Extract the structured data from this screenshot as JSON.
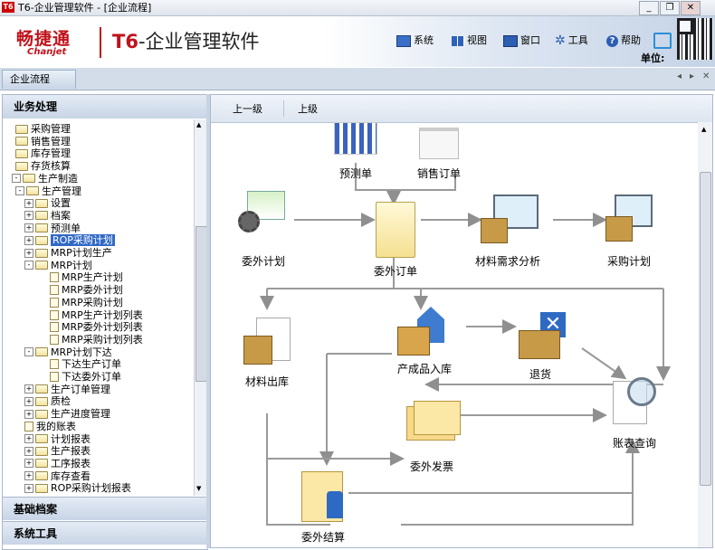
{
  "window": {
    "title": "T6-企业管理软件 - [企业流程]",
    "app_logo": "T6",
    "buttons": [
      "minimize",
      "restore",
      "close"
    ]
  },
  "banner": {
    "brand_cn": "畅捷通",
    "brand_en": "Chanjet",
    "product": "T6-企业管理软件",
    "menu": [
      {
        "label": "系统",
        "icon": "monitor-icon"
      },
      {
        "label": "视图",
        "icon": "grid-icon"
      },
      {
        "label": "窗口",
        "icon": "window-icon"
      },
      {
        "label": "工具",
        "icon": "gear-icon"
      },
      {
        "label": "帮助",
        "icon": "help-icon"
      }
    ],
    "unit_label": "单位:"
  },
  "tabs": [
    {
      "label": "企业流程",
      "active": true
    }
  ],
  "left": {
    "section_business": "业务处理",
    "section_basic": "基础档案",
    "section_tools": "系统工具",
    "tree": [
      {
        "label": "采购管理",
        "kind": "folder",
        "depth": 1,
        "toggle": ""
      },
      {
        "label": "销售管理",
        "kind": "folder",
        "depth": 1,
        "toggle": ""
      },
      {
        "label": "库存管理",
        "kind": "folder",
        "depth": 1,
        "toggle": ""
      },
      {
        "label": "存货核算",
        "kind": "folder",
        "depth": 1,
        "toggle": ""
      },
      {
        "label": "生产制造",
        "kind": "folder",
        "depth": 0,
        "toggle": "-"
      },
      {
        "label": "生产管理",
        "kind": "folder",
        "depth": 1,
        "toggle": "-"
      },
      {
        "label": "设置",
        "kind": "folder",
        "depth": 2,
        "toggle": "+"
      },
      {
        "label": "档案",
        "kind": "folder",
        "depth": 2,
        "toggle": "+"
      },
      {
        "label": "预测单",
        "kind": "folder",
        "depth": 2,
        "toggle": "+"
      },
      {
        "label": "ROP采购计划",
        "kind": "folder",
        "depth": 2,
        "toggle": "+",
        "selected": true
      },
      {
        "label": "MRP计划生产",
        "kind": "folder",
        "depth": 2,
        "toggle": "+"
      },
      {
        "label": "MRP计划",
        "kind": "folder",
        "depth": 2,
        "toggle": "-"
      },
      {
        "label": "MRP生产计划",
        "kind": "doc",
        "depth": 3,
        "toggle": ""
      },
      {
        "label": "MRP委外计划",
        "kind": "doc",
        "depth": 3,
        "toggle": ""
      },
      {
        "label": "MRP采购计划",
        "kind": "doc",
        "depth": 3,
        "toggle": ""
      },
      {
        "label": "MRP生产计划列表",
        "kind": "doc",
        "depth": 3,
        "toggle": ""
      },
      {
        "label": "MRP委外计划列表",
        "kind": "doc",
        "depth": 3,
        "toggle": ""
      },
      {
        "label": "MRP采购计划列表",
        "kind": "doc",
        "depth": 3,
        "toggle": ""
      },
      {
        "label": "MRP计划下达",
        "kind": "folder",
        "depth": 2,
        "toggle": "-"
      },
      {
        "label": "下达生产订单",
        "kind": "doc",
        "depth": 3,
        "toggle": ""
      },
      {
        "label": "下达委外订单",
        "kind": "doc",
        "depth": 3,
        "toggle": ""
      },
      {
        "label": "生产订单管理",
        "kind": "folder",
        "depth": 2,
        "toggle": "+"
      },
      {
        "label": "质检",
        "kind": "folder",
        "depth": 2,
        "toggle": "+"
      },
      {
        "label": "生产进度管理",
        "kind": "folder",
        "depth": 2,
        "toggle": "+"
      },
      {
        "label": "我的账表",
        "kind": "doc",
        "depth": 2,
        "toggle": ""
      },
      {
        "label": "计划报表",
        "kind": "folder",
        "depth": 2,
        "toggle": "+"
      },
      {
        "label": "生产报表",
        "kind": "folder",
        "depth": 2,
        "toggle": "+"
      },
      {
        "label": "工序报表",
        "kind": "folder",
        "depth": 2,
        "toggle": "+"
      },
      {
        "label": "库存查看",
        "kind": "folder",
        "depth": 2,
        "toggle": "+"
      },
      {
        "label": "ROP采购计划报表",
        "kind": "folder",
        "depth": 2,
        "toggle": "+"
      }
    ]
  },
  "right": {
    "toolbar": {
      "up_level_1": "上一级",
      "up_level_2": "上级"
    },
    "flow_nodes": {
      "forecast": "预测单",
      "sales_order": "销售订单",
      "outsource_plan": "委外计划",
      "outsource_order": "委外订单",
      "mrp": "材料需求分析",
      "purchase_plan": "采购计划",
      "material_out": "材料出库",
      "product_in": "产成品入库",
      "return": "退货",
      "report_query": "账表查询",
      "outsource_invoice": "委外发票",
      "outsource_settle": "委外结算"
    }
  },
  "colors": {
    "arrow": "#8f8f8f",
    "selected": "#3169c6",
    "brand": "#c1121b"
  }
}
